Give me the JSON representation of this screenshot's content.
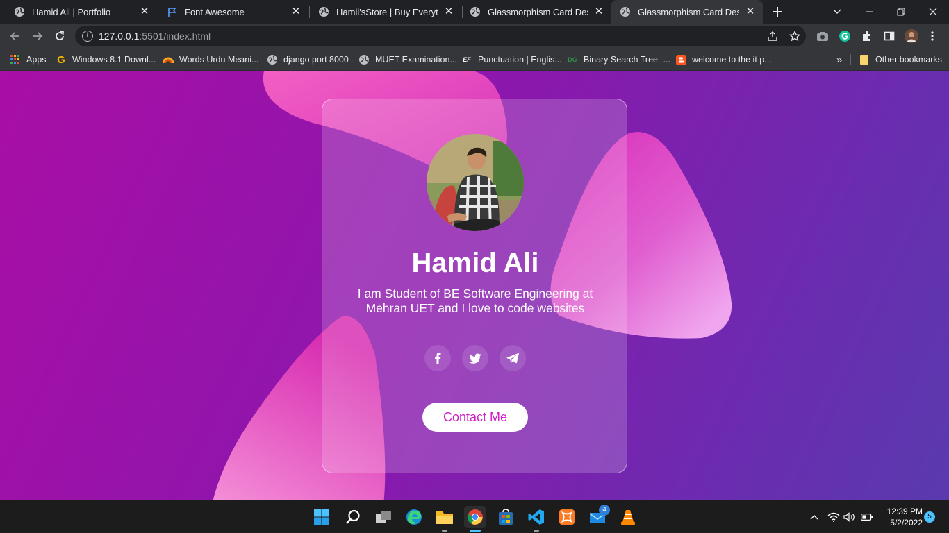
{
  "browser": {
    "tabs": [
      {
        "title": "Hamid Ali | Portfolio"
      },
      {
        "title": "Font Awesome"
      },
      {
        "title": "Hamii'sStore | Buy Everything"
      },
      {
        "title": "Glassmorphism Card Design"
      },
      {
        "title": "Glassmorphism Card Design",
        "active": true
      }
    ],
    "new_tab_icon": "plus-icon",
    "url": {
      "host": "127.0.0.1",
      "path": ":5501/index.html"
    },
    "bookmarks": [
      {
        "label": "Apps",
        "icon": "apps-grid-icon"
      },
      {
        "label": "Windows 8.1 Downl...",
        "icon": "G",
        "color": "#f4b400"
      },
      {
        "label": "Words Urdu Meani...",
        "icon": "rainbow-icon"
      },
      {
        "label": "django port 8000",
        "icon": "globe-icon"
      },
      {
        "label": "MUET Examination...",
        "icon": "globe-icon"
      },
      {
        "label": "Punctuation | Englis...",
        "icon": "EF"
      },
      {
        "label": "Binary Search Tree -...",
        "icon": "DG",
        "color": "#2f8d46"
      },
      {
        "label": "welcome to the it p...",
        "icon": "blogger-icon",
        "color": "#ff5722"
      }
    ],
    "more_bookmarks": "»",
    "other_bookmarks": "Other bookmarks"
  },
  "page": {
    "background_colors": [
      "#a90ea5",
      "#6a2cb0",
      "#5a3aae"
    ],
    "card": {
      "name": "Hamid Ali",
      "bio": "I am Student of BE Software Engineering at Mehran UET and I love to code websites",
      "socials": [
        "facebook-icon",
        "twitter-icon",
        "telegram-icon"
      ],
      "contact_label": "Contact Me",
      "accent": "#d01fc6"
    }
  },
  "taskbar": {
    "apps": [
      "start-icon",
      "search-icon",
      "task-view-icon",
      "edge-icon",
      "file-explorer-icon",
      "chrome-icon",
      "store-icon",
      "vscode-icon",
      "xampp-icon",
      "mail-icon",
      "vlc-icon"
    ],
    "mail_badge": "4",
    "clock": {
      "time": "12:39 PM",
      "date": "5/2/2022"
    },
    "notifications": "5"
  }
}
